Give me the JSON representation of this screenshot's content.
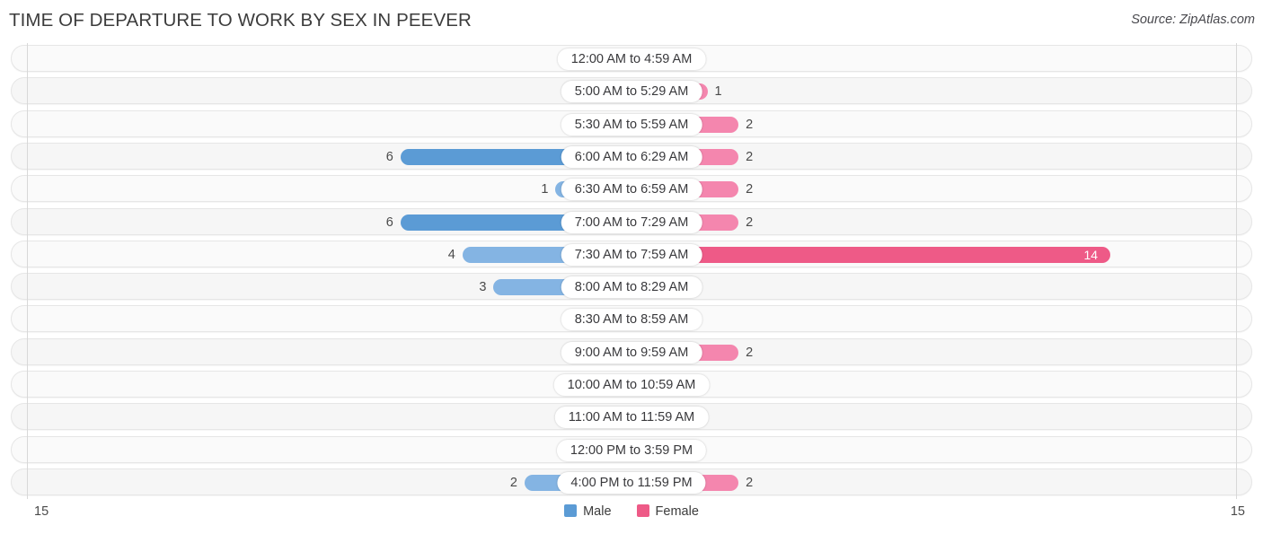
{
  "header": {
    "title": "TIME OF DEPARTURE TO WORK BY SEX IN PEEVER",
    "source": "Source: ZipAtlas.com"
  },
  "axis": {
    "left_tick": "15",
    "right_tick": "15",
    "max": 15
  },
  "legend": {
    "items": [
      {
        "label": "Male",
        "color": "#5B9BD5"
      },
      {
        "label": "Female",
        "color": "#EE5A87"
      }
    ]
  },
  "colors": {
    "male_strong": "#5B9BD5",
    "male_mid": "#84B4E3",
    "male_light": "#A9CBEA",
    "female_strong": "#EE5A87",
    "female_mid": "#F486AE",
    "female_light": "#F9AFCA",
    "row_bg": "#FAFAFA",
    "row_border": "#E6E6E6"
  },
  "chart_data": {
    "type": "bar",
    "subtype": "diverging-bidirectional",
    "title": "TIME OF DEPARTURE TO WORK BY SEX IN PEEVER",
    "xlabel": "",
    "ylabel": "",
    "xlim": [
      15,
      15
    ],
    "grid": false,
    "legend_position": "bottom-center",
    "categories": [
      "12:00 AM to 4:59 AM",
      "5:00 AM to 5:29 AM",
      "5:30 AM to 5:59 AM",
      "6:00 AM to 6:29 AM",
      "6:30 AM to 6:59 AM",
      "7:00 AM to 7:29 AM",
      "7:30 AM to 7:59 AM",
      "8:00 AM to 8:29 AM",
      "8:30 AM to 8:59 AM",
      "9:00 AM to 9:59 AM",
      "10:00 AM to 10:59 AM",
      "11:00 AM to 11:59 AM",
      "12:00 PM to 3:59 PM",
      "4:00 PM to 11:59 PM"
    ],
    "series": [
      {
        "name": "Male",
        "values": [
          0,
          0,
          0,
          6,
          1,
          6,
          4,
          3,
          0,
          0,
          0,
          0,
          0,
          2
        ]
      },
      {
        "name": "Female",
        "values": [
          0,
          1,
          2,
          2,
          2,
          2,
          14,
          0,
          0,
          2,
          0,
          0,
          0,
          2
        ]
      }
    ]
  },
  "rows": [
    {
      "category": "12:00 AM to 4:59 AM",
      "male": "0",
      "female": "0"
    },
    {
      "category": "5:00 AM to 5:29 AM",
      "male": "0",
      "female": "1"
    },
    {
      "category": "5:30 AM to 5:59 AM",
      "male": "0",
      "female": "2"
    },
    {
      "category": "6:00 AM to 6:29 AM",
      "male": "6",
      "female": "2"
    },
    {
      "category": "6:30 AM to 6:59 AM",
      "male": "1",
      "female": "2"
    },
    {
      "category": "7:00 AM to 7:29 AM",
      "male": "6",
      "female": "2"
    },
    {
      "category": "7:30 AM to 7:59 AM",
      "male": "4",
      "female": "14"
    },
    {
      "category": "8:00 AM to 8:29 AM",
      "male": "3",
      "female": "0"
    },
    {
      "category": "8:30 AM to 8:59 AM",
      "male": "0",
      "female": "0"
    },
    {
      "category": "9:00 AM to 9:59 AM",
      "male": "0",
      "female": "2"
    },
    {
      "category": "10:00 AM to 10:59 AM",
      "male": "0",
      "female": "0"
    },
    {
      "category": "11:00 AM to 11:59 AM",
      "male": "0",
      "female": "0"
    },
    {
      "category": "12:00 PM to 3:59 PM",
      "male": "0",
      "female": "0"
    },
    {
      "category": "4:00 PM to 11:59 PM",
      "male": "2",
      "female": "2"
    }
  ]
}
